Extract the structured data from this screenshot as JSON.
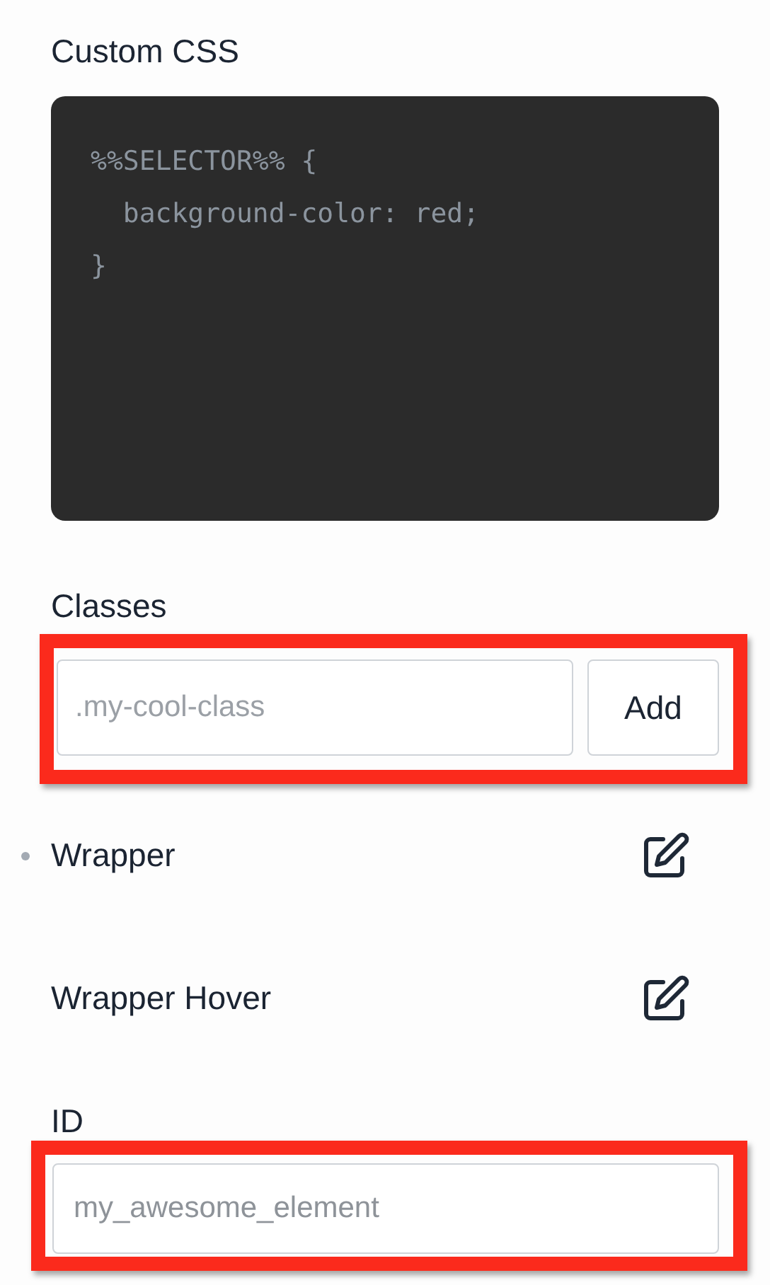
{
  "custom_css": {
    "label": "Custom CSS",
    "code_lines": [
      "%%SELECTOR%% {",
      "  background-color: red;",
      "}"
    ]
  },
  "classes": {
    "label": "Classes",
    "placeholder": ".my-cool-class",
    "button": "Add",
    "highlighted": true
  },
  "states": [
    {
      "label": "Wrapper",
      "marked": true
    },
    {
      "label": "Wrapper Hover",
      "marked": false
    }
  ],
  "id_field": {
    "label": "ID",
    "placeholder": "my_awesome_element",
    "highlighted": true
  }
}
